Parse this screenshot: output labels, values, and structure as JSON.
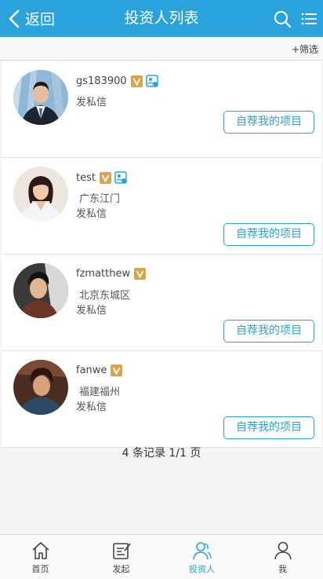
{
  "header": {
    "back_label": "返回",
    "title": "投资人列表",
    "accent": "#2aa3dc"
  },
  "filter": {
    "label": "+筛选"
  },
  "investors": [
    {
      "name": "gs183900",
      "location": "",
      "message_label": "发私信",
      "action_label": "自荐我的项目",
      "verified_id": true
    },
    {
      "name": "test",
      "location": "广东江门",
      "message_label": "发私信",
      "action_label": "自荐我的项目",
      "verified_id": true
    },
    {
      "name": "fzmatthew",
      "location": "北京东城区",
      "message_label": "发私信",
      "action_label": "自荐我的项目",
      "verified_id": false
    },
    {
      "name": "fanwe",
      "location": "福建福州",
      "message_label": "发私信",
      "action_label": "自荐我的项目",
      "verified_id": false
    }
  ],
  "summary": "4 条记录 1/1 页",
  "tabs": [
    {
      "label": "首页",
      "icon": "home-icon"
    },
    {
      "label": "发起",
      "icon": "edit-icon"
    },
    {
      "label": "投资人",
      "icon": "investors-icon",
      "active": true
    },
    {
      "label": "我",
      "icon": "user-icon"
    }
  ]
}
